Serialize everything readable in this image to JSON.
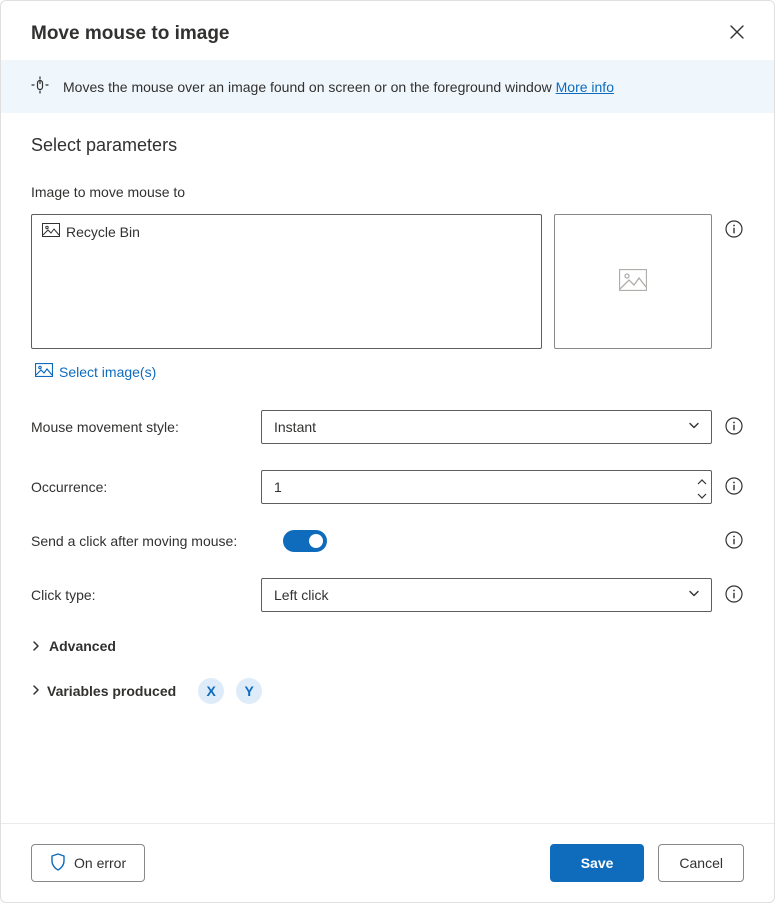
{
  "header": {
    "title": "Move mouse to image"
  },
  "infoBar": {
    "text": "Moves the mouse over an image found on screen or on the foreground window ",
    "moreInfo": "More info"
  },
  "section_heading": "Select parameters",
  "imageField": {
    "label": "Image to move mouse to",
    "selected_name": "Recycle Bin",
    "select_link": "Select image(s)"
  },
  "fields": {
    "movement_label": "Mouse movement style:",
    "movement_value": "Instant",
    "occurrence_label": "Occurrence:",
    "occurrence_value": "1",
    "sendclick_label": "Send a click after moving mouse:",
    "clicktype_label": "Click type:",
    "clicktype_value": "Left click"
  },
  "expanders": {
    "advanced": "Advanced",
    "variables": "Variables produced",
    "var_x": "X",
    "var_y": "Y"
  },
  "footer": {
    "onerror": "On error",
    "save": "Save",
    "cancel": "Cancel"
  }
}
